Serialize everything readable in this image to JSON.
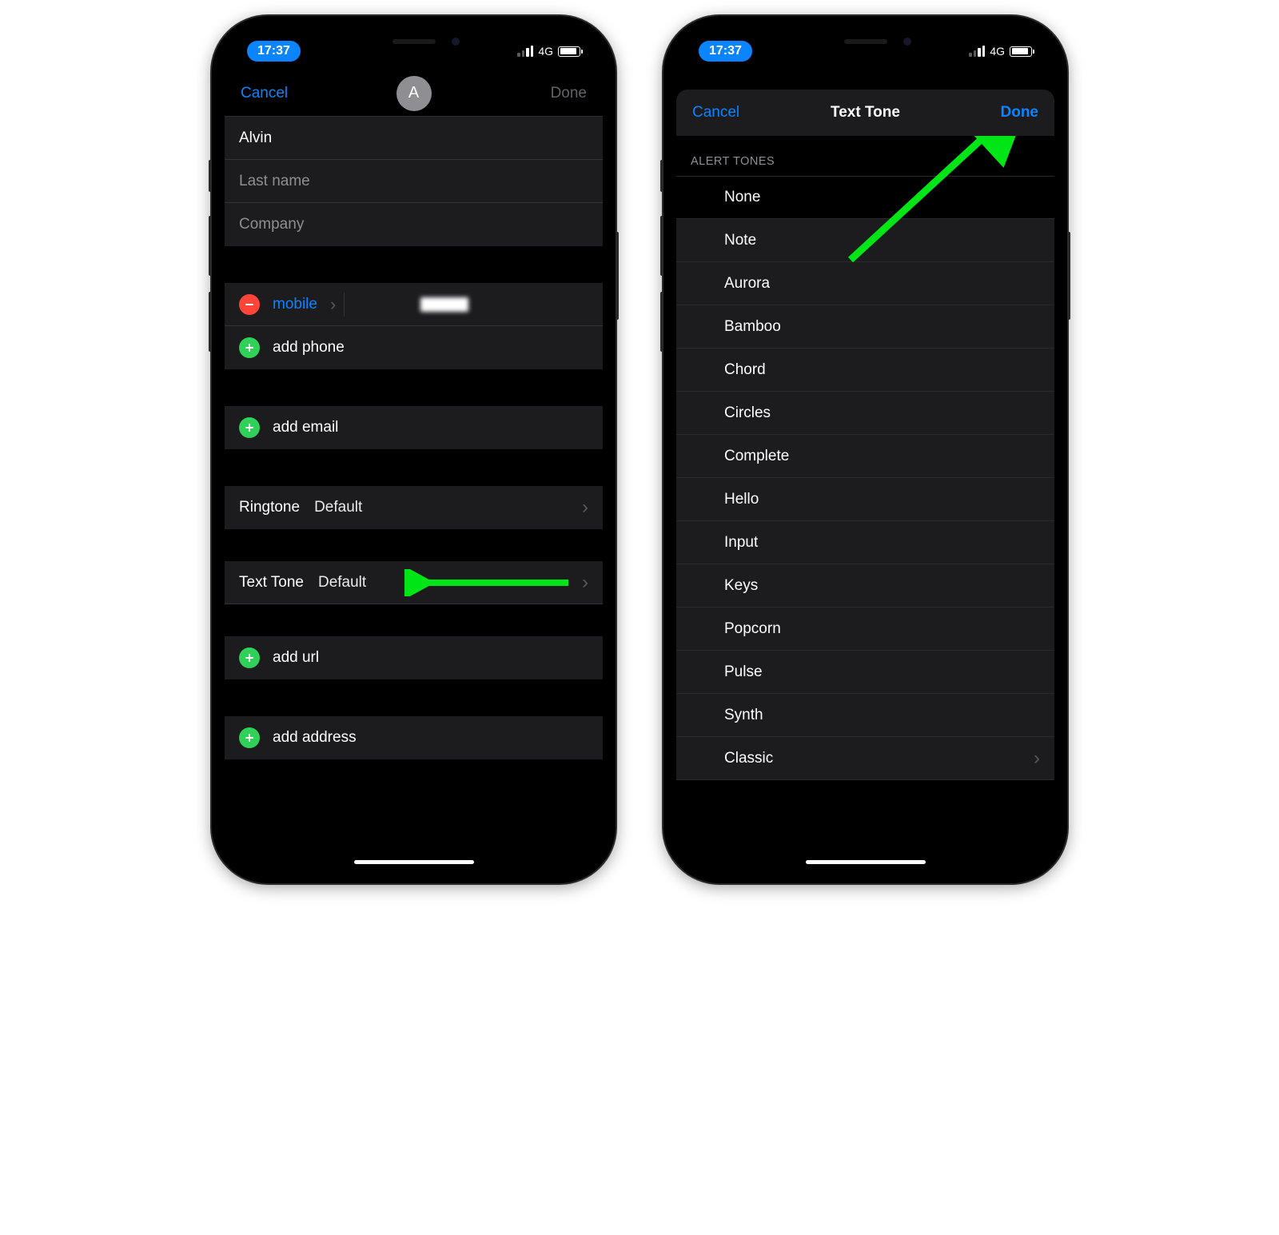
{
  "status": {
    "time": "17:37",
    "network": "4G"
  },
  "left": {
    "nav": {
      "cancel": "Cancel",
      "done": "Done",
      "avatar_initial": "A"
    },
    "name_fields": {
      "first_name": "Alvin",
      "last_name_ph": "Last name",
      "company_ph": "Company"
    },
    "phone": {
      "label": "mobile",
      "add_phone": "add phone"
    },
    "email": {
      "add_email": "add email"
    },
    "ringtone": {
      "label": "Ringtone",
      "value": "Default"
    },
    "texttone": {
      "label": "Text Tone",
      "value": "Default"
    },
    "url": {
      "add_url": "add url"
    },
    "address": {
      "add_address": "add address"
    }
  },
  "right": {
    "nav": {
      "cancel": "Cancel",
      "title": "Text Tone",
      "done": "Done"
    },
    "section_header": "ALERT TONES",
    "tones": [
      "None",
      "Note",
      "Aurora",
      "Bamboo",
      "Chord",
      "Circles",
      "Complete",
      "Hello",
      "Input",
      "Keys",
      "Popcorn",
      "Pulse",
      "Synth",
      "Classic"
    ]
  }
}
